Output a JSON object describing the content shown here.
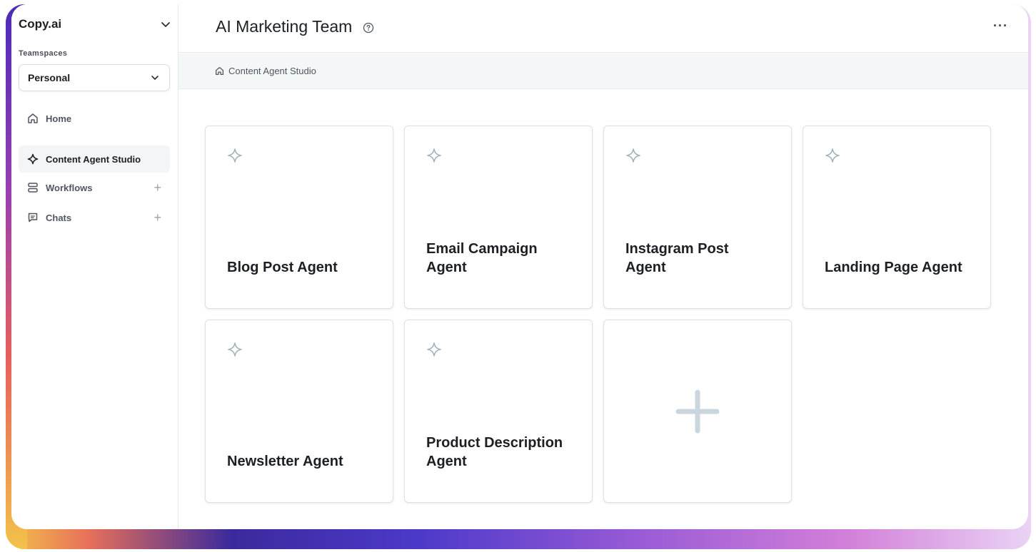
{
  "sidebar": {
    "brand": "Copy.ai",
    "teamspaces_label": "Teamspaces",
    "teamspace_selected": "Personal",
    "nav": [
      {
        "label": "Home",
        "icon": "home-icon"
      },
      {
        "label": "Content Agent Studio",
        "icon": "sparkle-diamond-icon",
        "active": true
      },
      {
        "label": "Workflows",
        "icon": "workflow-icon",
        "add": "+"
      },
      {
        "label": "Chats",
        "icon": "chat-icon",
        "add": "+"
      }
    ]
  },
  "header": {
    "title": "AI Marketing Team",
    "more": "···"
  },
  "breadcrumb": {
    "label": "Content Agent Studio"
  },
  "agents": [
    {
      "label": "Blog Post Agent"
    },
    {
      "label": "Email Campaign Agent"
    },
    {
      "label": "Instagram Post Agent"
    },
    {
      "label": "Landing Page Agent"
    },
    {
      "label": "Newsletter Agent"
    },
    {
      "label": "Product Description Agent"
    }
  ],
  "colors": {
    "accent_icon": "#9fb3bd",
    "plus_icon": "#c9d6dd",
    "text": "#1d1f24"
  }
}
